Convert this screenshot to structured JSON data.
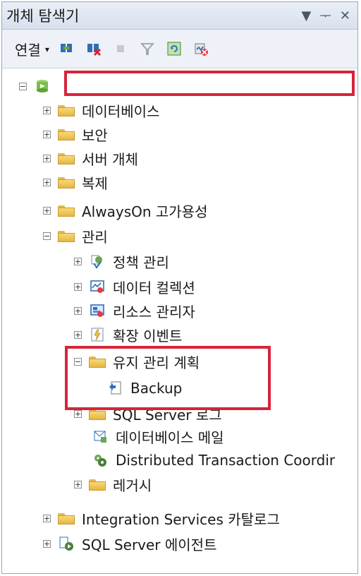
{
  "window": {
    "title": "개체 탐색기",
    "buttons": {
      "menu": "▼",
      "pin": "ᅮ",
      "close": "✕"
    }
  },
  "toolbar": {
    "connect_label": "연결",
    "connect_caret": "▾",
    "icons": [
      "connect-icon",
      "disconnect-icon",
      "stop-icon",
      "filter-icon",
      "refresh-icon",
      "activity-monitor-icon"
    ]
  },
  "tree": {
    "server_name": "",
    "items": [
      "데이터베이스",
      "보안",
      "서버 개체",
      "복제",
      "AlwaysOn 고가용성",
      "관리",
      "정책 관리",
      "데이터 컬렉션",
      "리소스 관리자",
      "확장 이벤트",
      "유지 관리 계획",
      "Backup",
      "SQL Server 로그",
      "데이터베이스 메일",
      "Distributed Transaction Coordir",
      "레거시",
      "Integration Services 카탈로그",
      "SQL Server 에이전트"
    ]
  },
  "colors": {
    "highlight": "#d6243a",
    "folder": "#f2c94c"
  }
}
